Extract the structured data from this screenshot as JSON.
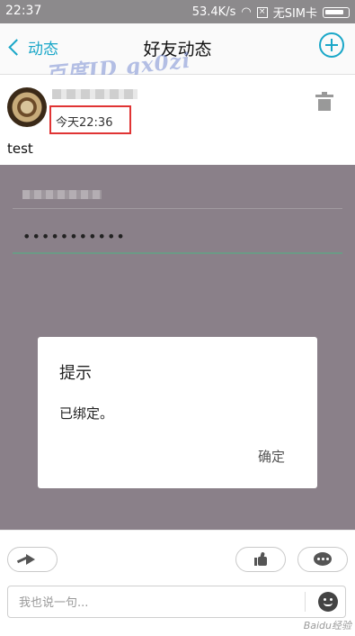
{
  "status_bar": {
    "time": "22:37",
    "speed": "53.4K/s",
    "sim": "无SIM卡"
  },
  "nav": {
    "back_label": "动态",
    "title": "好友动态"
  },
  "watermark_text": "百度ID gx0zi",
  "post": {
    "time": "今天22:36",
    "text": "test"
  },
  "background_form": {
    "password_mask": "•••••••••••"
  },
  "dialog": {
    "title": "提示",
    "message": "已绑定。",
    "ok_label": "确定"
  },
  "comment_input": {
    "placeholder": "我也说一句..."
  },
  "footer_watermark": "Baidu经验",
  "colors": {
    "accent": "#1aa7c8",
    "highlight_box": "#e03434",
    "dim_overlay": "#8a8089"
  }
}
